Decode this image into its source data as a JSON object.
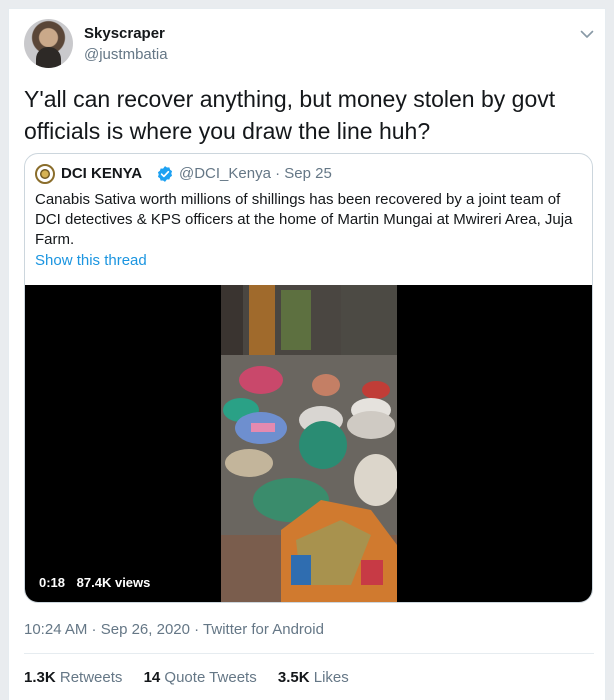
{
  "tweet": {
    "author_name": "Skyscraper",
    "author_handle": "@justmbatia",
    "text": "Y'all can recover anything, but money stolen by govt officials is where you draw the line huh?",
    "timestamp": "10:24 AM",
    "date": "Sep 26, 2020",
    "source": "Twitter for Android"
  },
  "quote": {
    "author_name": "DCI KENYA",
    "author_handle": "@DCI_Kenya",
    "date": "Sep 25",
    "text": "Canabis Sativa worth millions of shillings has been recovered by a joint team of DCI detectives & KPS officers at the home of Martin Mungai at Mwireri Area, Juja Farm.",
    "show_thread": "Show this thread",
    "video": {
      "duration": "0:18",
      "views": "87.4K views"
    }
  },
  "stats": {
    "retweets_count": "1.3K",
    "retweets_label": "Retweets",
    "quotes_count": "14",
    "quotes_label": "Quote Tweets",
    "likes_count": "3.5K",
    "likes_label": "Likes"
  },
  "colors": {
    "link": "#1b95e0",
    "secondary_text": "#657786",
    "verified": "#1da1f2"
  },
  "icons": [
    "chevron-down-icon",
    "verified-badge-icon"
  ]
}
